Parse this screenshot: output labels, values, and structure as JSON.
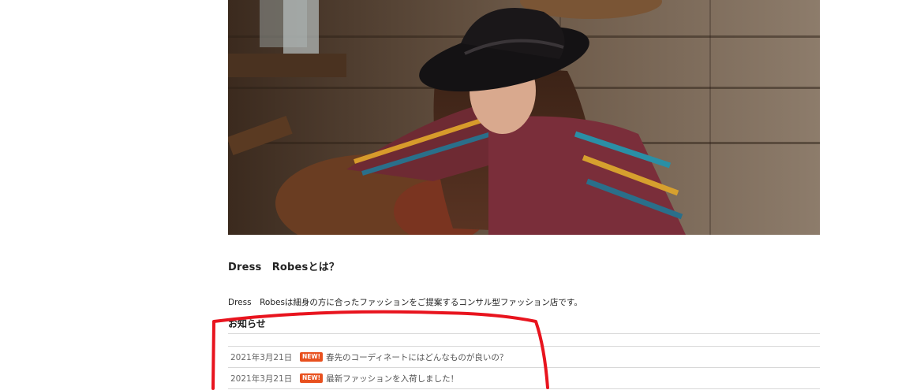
{
  "about": {
    "title": "Dress　Robesとは？",
    "text": "Dress　Robesは細身の方に合ったファッションをご提案するコンサル型ファッション店です。"
  },
  "news": {
    "title": "お知らせ",
    "items": [
      {
        "date": "2021年3月21日",
        "badge": "NEW!",
        "text": "春先のコーディネートにはどんなものが良いの？"
      },
      {
        "date": "2021年3月21日",
        "badge": "NEW!",
        "text": "最新ファッションを入荷しました！"
      }
    ]
  },
  "colors": {
    "badge": "#e8501e",
    "annotation": "#e8141e",
    "divider": "#d8d8d8"
  }
}
